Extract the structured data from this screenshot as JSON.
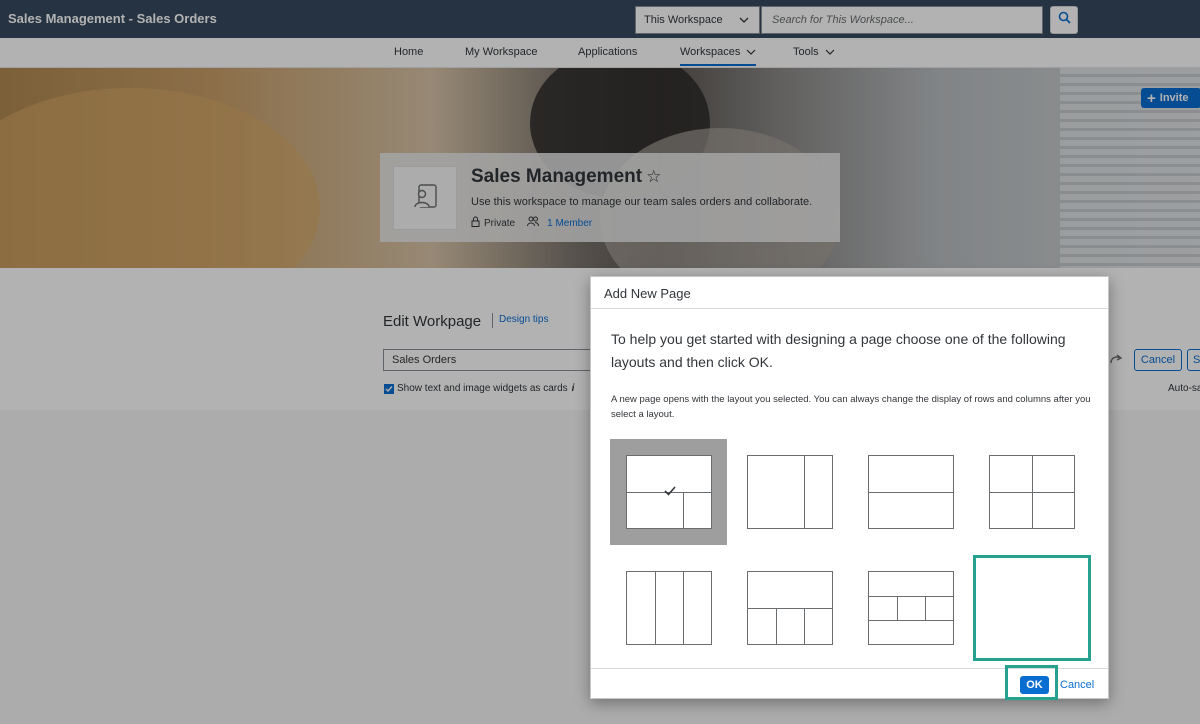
{
  "shell": {
    "app_title": "Sales Management - Sales Orders",
    "scope_select": "This Workspace",
    "search_placeholder": "Search for This Workspace..."
  },
  "nav": {
    "items": [
      {
        "label": "Home"
      },
      {
        "label": "My Workspace"
      },
      {
        "label": "Applications"
      },
      {
        "label": "Workspaces",
        "active": true
      },
      {
        "label": "Tools"
      }
    ]
  },
  "hero": {
    "invite_label": "Invite"
  },
  "workspace": {
    "title": "Sales Management",
    "star": "☆",
    "description": "Use this workspace to manage our team sales orders and collaborate.",
    "visibility": "Private",
    "members": "1 Member"
  },
  "editor": {
    "title": "Edit Workpage",
    "design_tips": "Design tips",
    "page_name": "Sales Orders",
    "show_cards_label": "Show text and image widgets as cards",
    "info_glyph": "i",
    "cancel_label": "Cancel",
    "save_label": "S",
    "autosave_label": "Auto-sa"
  },
  "dialog": {
    "title": "Add New Page",
    "intro": "To help you get started with designing a page choose one of the following layouts and then click OK.",
    "note": "A new page opens with the layout you selected. You can always change the display of rows and columns after you select a layout.",
    "layouts_selected_index": 0,
    "layouts_hover_index": 7,
    "ok_label": "OK",
    "cancel_label": "Cancel"
  },
  "colors": {
    "shell_bg": "#354a5f",
    "accent": "#0a6ed1",
    "highlight": "#26a18f",
    "selected_layout_bg": "#9e9e9e"
  }
}
